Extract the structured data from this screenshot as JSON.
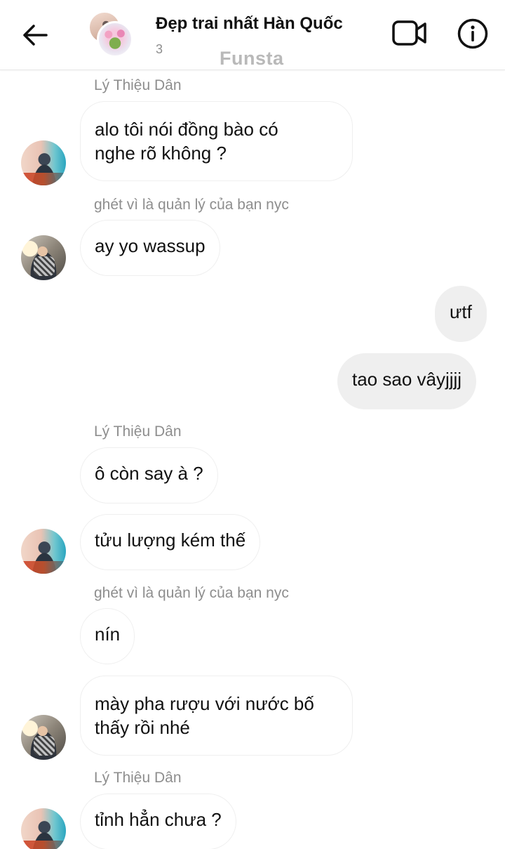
{
  "header": {
    "title": "Đẹp trai nhất Hàn Quốc",
    "member_count": "3",
    "watermark": "Funsta",
    "icons": {
      "back": "back-arrow-icon",
      "video": "video-call-icon",
      "info": "info-icon"
    }
  },
  "messages": [
    {
      "sender": "Lý Thiệu Dân",
      "text": [
        "alo tôi nói đồng bào có",
        "nghe rõ không ?"
      ],
      "mine": false,
      "avatar": "avatar-a"
    },
    {
      "sender": "ghét vì là quản lý của bạn nyc",
      "text": [
        "ay yo wassup"
      ],
      "mine": false,
      "avatar": "avatar-b"
    },
    {
      "sender": "",
      "text": [
        "ưtf"
      ],
      "mine": true
    },
    {
      "sender": "",
      "text": [
        "tao sao vâyjjjj"
      ],
      "mine": true
    },
    {
      "sender": "Lý Thiệu Dân",
      "text": [
        "ô còn say à ?"
      ],
      "mine": false
    },
    {
      "sender": "",
      "text": [
        "tửu lượng kém thế"
      ],
      "mine": false,
      "avatar": "avatar-a"
    },
    {
      "sender": "ghét vì là quản lý của bạn nyc",
      "text": [
        "nín"
      ],
      "mine": false
    },
    {
      "sender": "",
      "text": [
        "mày pha rượu với nước bố",
        "thấy rồi nhé"
      ],
      "mine": false,
      "avatar": "avatar-b"
    },
    {
      "sender": "Lý Thiệu Dân",
      "text": [
        "tỉnh hẳn chưa ?"
      ],
      "mine": false,
      "avatar": "avatar-a"
    }
  ]
}
